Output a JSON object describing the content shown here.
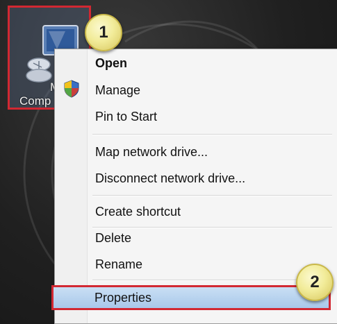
{
  "desktop_icon": {
    "label_line1": "My",
    "label_line2": "Comp"
  },
  "badges": {
    "step1": "1",
    "step2": "2"
  },
  "menu": {
    "items": [
      {
        "label": "Open"
      },
      {
        "label": "Manage"
      },
      {
        "label": "Pin to Start"
      },
      {
        "label": "Map network drive..."
      },
      {
        "label": "Disconnect network drive..."
      },
      {
        "label": "Create shortcut"
      },
      {
        "label": "Delete"
      },
      {
        "label": "Rename"
      },
      {
        "label": "Properties"
      }
    ]
  },
  "colors": {
    "highlight_border": "#d22832",
    "selected_item": "#b7d3f0",
    "badge": "#f2ec9a"
  }
}
